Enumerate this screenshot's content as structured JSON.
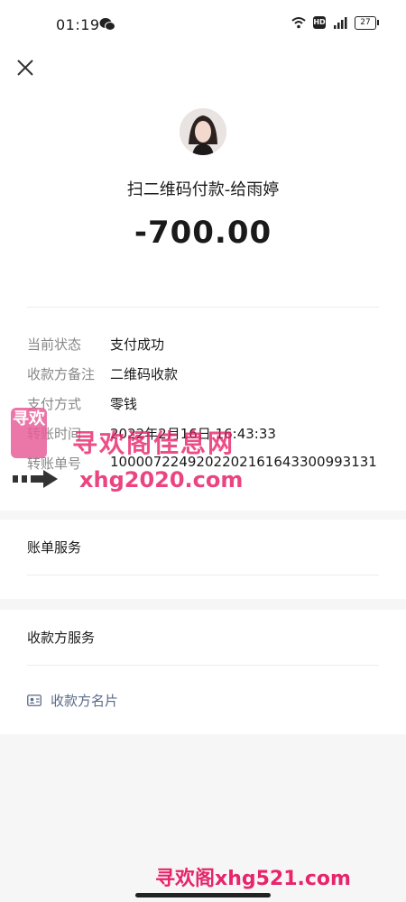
{
  "status_bar": {
    "time": "01:19",
    "battery": "27",
    "icons": [
      "wechat-icon",
      "wifi-icon",
      "hd-icon",
      "4g-signal-icon",
      "battery-icon"
    ]
  },
  "header": {
    "title": "扫二维码付款-给雨婷",
    "amount": "-700.00"
  },
  "details": {
    "rows": [
      {
        "label": "当前状态",
        "value": "支付成功"
      },
      {
        "label": "收款方备注",
        "value": "二维码收款"
      },
      {
        "label": "支付方式",
        "value": "零钱"
      },
      {
        "label": "转账时间",
        "value": "2022年2月16日 16:43:33"
      },
      {
        "label": "转账单号",
        "value": "1000072249202202161643300993131"
      }
    ]
  },
  "bill_service": {
    "title": "账单服务"
  },
  "payee_service": {
    "title": "收款方服务",
    "card_link": "收款方名片"
  },
  "watermark": {
    "logo": "寻欢",
    "text": "寻欢阁佳息网",
    "url": "xhg2020.com",
    "bottom": "寻欢阁xhg521.com"
  },
  "colors": {
    "accent": "#e8246a",
    "link": "#5a6a88",
    "label": "#888888"
  }
}
